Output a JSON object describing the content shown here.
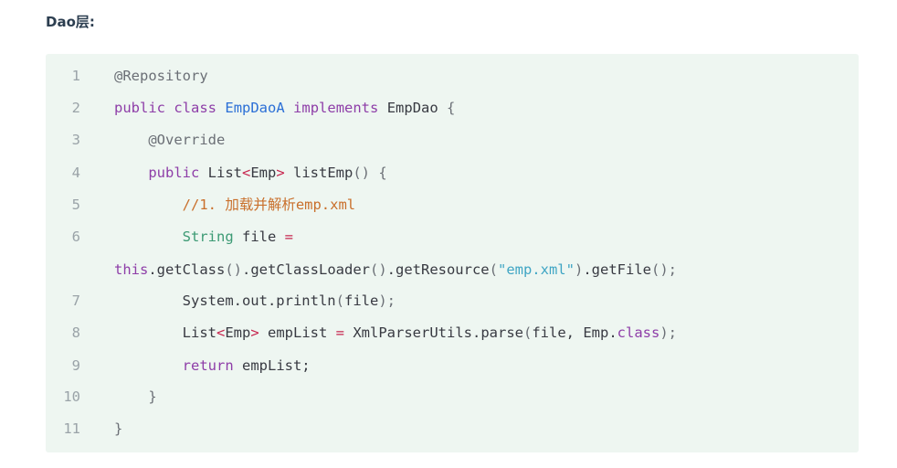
{
  "heading": "Dao层:",
  "code": {
    "lines": [
      {
        "num": "1",
        "tokens": [
          {
            "t": "@Repository",
            "c": "ann"
          }
        ]
      },
      {
        "num": "2",
        "tokens": [
          {
            "t": "public",
            "c": "kw"
          },
          {
            "t": " ",
            "c": ""
          },
          {
            "t": "class",
            "c": "kw"
          },
          {
            "t": " ",
            "c": ""
          },
          {
            "t": "EmpDaoA",
            "c": "cls"
          },
          {
            "t": " ",
            "c": ""
          },
          {
            "t": "implements",
            "c": "kw"
          },
          {
            "t": " ",
            "c": ""
          },
          {
            "t": "EmpDao",
            "c": ""
          },
          {
            "t": " ",
            "c": ""
          },
          {
            "t": "{",
            "c": "punc"
          }
        ]
      },
      {
        "num": "3",
        "tokens": [
          {
            "t": "    ",
            "c": ""
          },
          {
            "t": "@Override",
            "c": "ann"
          }
        ]
      },
      {
        "num": "4",
        "tokens": [
          {
            "t": "    ",
            "c": ""
          },
          {
            "t": "public",
            "c": "kw"
          },
          {
            "t": " List",
            "c": ""
          },
          {
            "t": "<",
            "c": "op"
          },
          {
            "t": "Emp",
            "c": ""
          },
          {
            "t": ">",
            "c": "op"
          },
          {
            "t": " listEmp",
            "c": ""
          },
          {
            "t": "() {",
            "c": "punc"
          }
        ]
      },
      {
        "num": "5",
        "tokens": [
          {
            "t": "        ",
            "c": ""
          },
          {
            "t": "//1. 加载并解析emp.xml",
            "c": "cmt"
          }
        ]
      },
      {
        "num": "6",
        "tokens": [
          {
            "t": "        ",
            "c": ""
          },
          {
            "t": "String",
            "c": "typ"
          },
          {
            "t": " file ",
            "c": ""
          },
          {
            "t": "=",
            "c": "op"
          }
        ]
      },
      {
        "num": "",
        "tokens": [
          {
            "t": "this",
            "c": "kw"
          },
          {
            "t": ".getClass",
            "c": ""
          },
          {
            "t": "()",
            "c": "punc"
          },
          {
            "t": ".getClassLoader",
            "c": ""
          },
          {
            "t": "()",
            "c": "punc"
          },
          {
            "t": ".getResource",
            "c": ""
          },
          {
            "t": "(",
            "c": "punc"
          },
          {
            "t": "\"emp.xml\"",
            "c": "str"
          },
          {
            "t": ")",
            "c": "punc"
          },
          {
            "t": ".getFile",
            "c": ""
          },
          {
            "t": "();",
            "c": "punc"
          }
        ]
      },
      {
        "num": "7",
        "tokens": [
          {
            "t": "        ",
            "c": ""
          },
          {
            "t": "System.out.println",
            "c": ""
          },
          {
            "t": "(",
            "c": "punc"
          },
          {
            "t": "file",
            "c": ""
          },
          {
            "t": ");",
            "c": "punc"
          }
        ]
      },
      {
        "num": "8",
        "tokens": [
          {
            "t": "        ",
            "c": ""
          },
          {
            "t": "List",
            "c": ""
          },
          {
            "t": "<",
            "c": "op"
          },
          {
            "t": "Emp",
            "c": ""
          },
          {
            "t": ">",
            "c": "op"
          },
          {
            "t": " empList ",
            "c": ""
          },
          {
            "t": "=",
            "c": "op"
          },
          {
            "t": " XmlParserUtils.parse",
            "c": ""
          },
          {
            "t": "(",
            "c": "punc"
          },
          {
            "t": "file, Emp.",
            "c": ""
          },
          {
            "t": "class",
            "c": "kw"
          },
          {
            "t": ");",
            "c": "punc"
          }
        ]
      },
      {
        "num": "9",
        "tokens": [
          {
            "t": "        ",
            "c": ""
          },
          {
            "t": "return",
            "c": "kw"
          },
          {
            "t": " empList;",
            "c": ""
          }
        ]
      },
      {
        "num": "10",
        "tokens": [
          {
            "t": "    ",
            "c": ""
          },
          {
            "t": "}",
            "c": "punc"
          }
        ]
      },
      {
        "num": "11",
        "tokens": [
          {
            "t": "}",
            "c": "punc"
          }
        ]
      }
    ]
  }
}
